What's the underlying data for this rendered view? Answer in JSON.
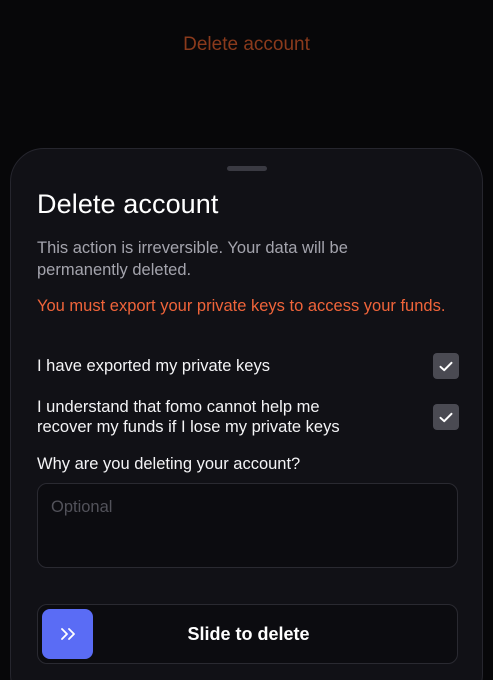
{
  "background_screen": {
    "title": "Delete account",
    "title_color": "#8a3a1c"
  },
  "sheet": {
    "title": "Delete account",
    "description": "This action is irreversible. Your data will be permanently deleted.",
    "warning": "You must export your private keys to access your funds.",
    "warning_color": "#f0643a",
    "checkboxes": [
      {
        "label": "I have exported my private keys",
        "checked": true,
        "icon": "check-icon"
      },
      {
        "label": "I understand that fomo cannot help me recover my funds if I lose my private keys",
        "checked": true,
        "icon": "check-icon"
      }
    ],
    "reason": {
      "label": "Why are you deleting your account?",
      "placeholder": "Optional",
      "value": ""
    },
    "slider": {
      "label": "Slide to delete",
      "icon": "double-chevron-right-icon",
      "accent_color": "#5a6cf5",
      "progress": 0
    }
  }
}
